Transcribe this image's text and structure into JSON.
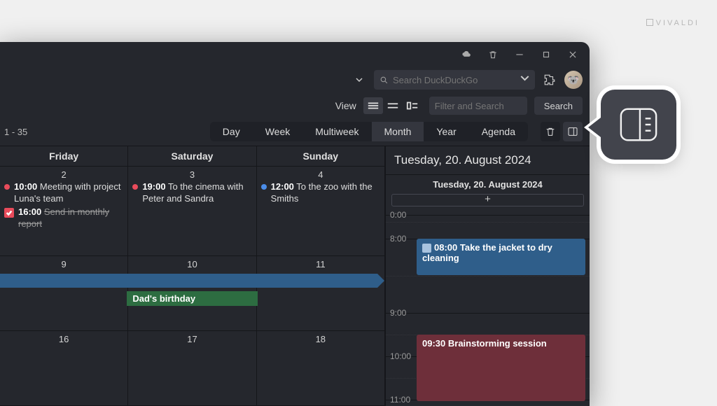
{
  "brand": "VIVALDI",
  "search": {
    "placeholder": "Search DuckDuckGo"
  },
  "view": {
    "label": "View",
    "filter_placeholder": "Filter and Search",
    "search_button": "Search"
  },
  "range": {
    "week_range": "1 - 35",
    "tabs": [
      "Day",
      "Week",
      "Multiweek",
      "Month",
      "Year",
      "Agenda"
    ],
    "active": "Month"
  },
  "month": {
    "day_headers": [
      "Friday",
      "Saturday",
      "Sunday"
    ],
    "rows": [
      {
        "cells": [
          {
            "daynum": "2",
            "events": [
              {
                "dot": "red",
                "time": "10:00",
                "text": "Meeting with project Luna's team"
              },
              {
                "chk": true,
                "time": "16:00",
                "text": "Send in monthly report",
                "struck": true
              }
            ]
          },
          {
            "daynum": "3",
            "events": [
              {
                "dot": "red",
                "time": "19:00",
                "text": "To the cinema with Peter and Sandra"
              }
            ]
          },
          {
            "daynum": "4",
            "events": [
              {
                "dot": "blue",
                "time": "12:00",
                "text": "To the zoo with the Smiths"
              }
            ]
          }
        ]
      },
      {
        "cells": [
          {
            "daynum": "9",
            "stripe_left": true
          },
          {
            "daynum": "10",
            "stripe_mid": true,
            "green_label": "Dad's birthday"
          },
          {
            "daynum": "11",
            "stripe_arrow": true
          }
        ]
      },
      {
        "cells": [
          {
            "daynum": "16"
          },
          {
            "daynum": "17"
          },
          {
            "daynum": "18"
          }
        ]
      }
    ]
  },
  "day_panel": {
    "title": "Tuesday, 20. August 2024",
    "subtitle": "Tuesday, 20. August 2024",
    "add_label": "+",
    "hours": [
      "0:00",
      "8:00",
      "9:00",
      "10:00",
      "11:00"
    ],
    "events": [
      {
        "color": "blue",
        "time": "08:00",
        "text": "Take the jacket to dry cleaning"
      },
      {
        "color": "red",
        "time": "09:30",
        "text": "Brainstorming session"
      }
    ]
  }
}
